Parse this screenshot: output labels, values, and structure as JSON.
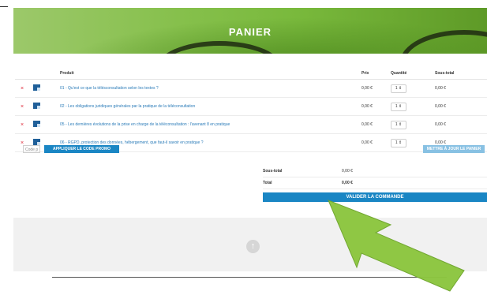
{
  "header": {
    "title": "PANIER"
  },
  "cart": {
    "columns": {
      "product": "Produit",
      "price": "Prix",
      "quantity": "Quantité",
      "subtotal": "Sous-total"
    },
    "items": [
      {
        "remove": "×",
        "name": "01 - Qu'est ce que la télésconsultation selon les textes ?",
        "price": "0,00 €",
        "qty": "1 ⇕",
        "subtotal": "0,00 €"
      },
      {
        "remove": "×",
        "name": "02 - Les obligations juridiques générales par la pratique de la téléconsultation",
        "price": "0,00 €",
        "qty": "1 ⇕",
        "subtotal": "0,00 €"
      },
      {
        "remove": "×",
        "name": "05 - Les dernières évolutions de la prise en charge de la téléconsultation : l'avenant 8 en pratique",
        "price": "0,00 €",
        "qty": "1 ⇕",
        "subtotal": "0,00 €"
      },
      {
        "remove": "×",
        "name": "06 - RGPD, protection des données, hébergement, que faut-il savoir en pratique ?",
        "price": "0,00 €",
        "qty": "1 ⇕",
        "subtotal": "0,00 €"
      }
    ],
    "coupon_placeholder": "Code p",
    "apply_coupon_label": "APPLIQUER LE CODE PROMO",
    "update_cart_label": "METTRE À JOUR LE PANIER"
  },
  "totals": {
    "subtotal_label": "Sous-total",
    "subtotal_value": "0,00 €",
    "total_label": "Total",
    "total_value": "0,00 €",
    "checkout_label": "VALIDER LA COMMANDE"
  },
  "footer": {
    "scroll_top_icon": "arrow-up-icon"
  },
  "colors": {
    "accent": "#1a86c4",
    "hero_green": "#79b93c",
    "arrow_green": "#8cc63f",
    "remove_red": "#dd2233"
  }
}
